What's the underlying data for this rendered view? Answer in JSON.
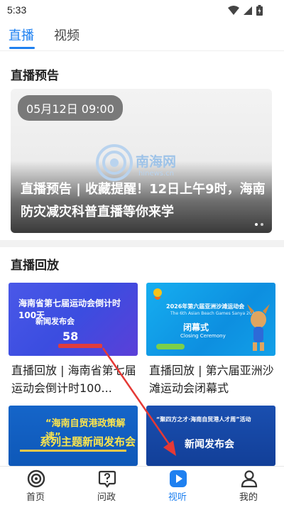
{
  "status_bar": {
    "time": "5:33"
  },
  "top_tabs": [
    {
      "label": "直播",
      "active": true
    },
    {
      "label": "视频",
      "active": false
    }
  ],
  "live_preview": {
    "section_title": "直播预告",
    "time_pill": "05月12日 09:00",
    "title": "直播预告 | 收藏提醒！12日上午9时，海南防灾减灾科普直播等你来学",
    "watermark": {
      "text": "南海网",
      "sub": "hinews.cn"
    }
  },
  "live_replay": {
    "section_title": "直播回放",
    "items": [
      {
        "caption": "直播回放 | 海南省第七届运动会倒计时100...",
        "thumb_lines": [
          "海南省第七届运动会倒计时100天",
          "新闻发布会"
        ],
        "thumb_number": "58"
      },
      {
        "caption": "直播回放 | 第六届亚洲沙滩运动会闭幕式",
        "thumb_lines": [
          "2026年第六届亚洲沙滩运动会",
          "The 6th Asian Beach Games Sanya 2026",
          "闭幕式",
          "Closing Ceremony"
        ]
      },
      {
        "caption": "",
        "thumb_lines": [
          "“海南自贸港政策解读”",
          "系列主题新闻发布会"
        ]
      },
      {
        "caption": "",
        "thumb_lines": [
          "“聚四方之才·海南自贸港人才周”活动",
          "新闻发布会"
        ]
      }
    ]
  },
  "bottom_nav": [
    {
      "label": "首页",
      "icon": "home-logo-icon",
      "active": false
    },
    {
      "label": "问政",
      "icon": "question-bubble-icon",
      "active": false
    },
    {
      "label": "视听",
      "icon": "play-icon",
      "active": true
    },
    {
      "label": "我的",
      "icon": "person-icon",
      "active": false
    }
  ],
  "colors": {
    "accent": "#1e80f0",
    "annotation_arrow": "#e53935"
  }
}
